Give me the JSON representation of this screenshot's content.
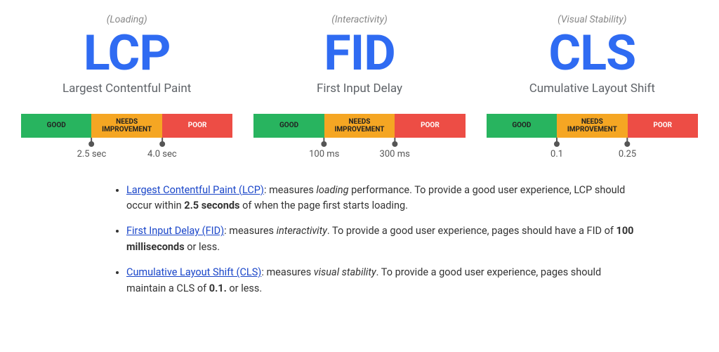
{
  "metrics": [
    {
      "category": "(Loading)",
      "acronym": "LCP",
      "name": "Largest Contentful Paint",
      "thresholds": [
        "2.5 sec",
        "4.0 sec"
      ]
    },
    {
      "category": "(Interactivity)",
      "acronym": "FID",
      "name": "First Input Delay",
      "thresholds": [
        "100 ms",
        "300 ms"
      ]
    },
    {
      "category": "(Visual Stability)",
      "acronym": "CLS",
      "name": "Cumulative Layout Shift",
      "thresholds": [
        "0.1",
        "0.25"
      ]
    }
  ],
  "bar_labels": {
    "good": "GOOD",
    "needs": "NEEDS IMPROVEMENT",
    "poor": "POOR"
  },
  "colors": {
    "accent_blue": "#2F6BF2",
    "good": "#28b45f",
    "needs": "#f5a623",
    "poor": "#ed4d45",
    "link": "#1a46c9"
  },
  "bullets": [
    {
      "link": "Largest Contentful Paint (LCP)",
      "pre": ": measures ",
      "ital": "loading",
      "mid": " performance. To provide a good user experience, LCP should occur within ",
      "bold": "2.5 seconds",
      "post": " of when the page first starts loading."
    },
    {
      "link": "First Input Delay (FID)",
      "pre": ": measures ",
      "ital": "interactivity",
      "mid": ". To provide a good user experience, pages should have a FID of ",
      "bold": "100 milliseconds",
      "post": " or less."
    },
    {
      "link": "Cumulative Layout Shift (CLS)",
      "pre": ": measures ",
      "ital": "visual stability",
      "mid": ". To provide a good user experience, pages should maintain a CLS of ",
      "bold": "0.1.",
      "post": " or less."
    }
  ]
}
